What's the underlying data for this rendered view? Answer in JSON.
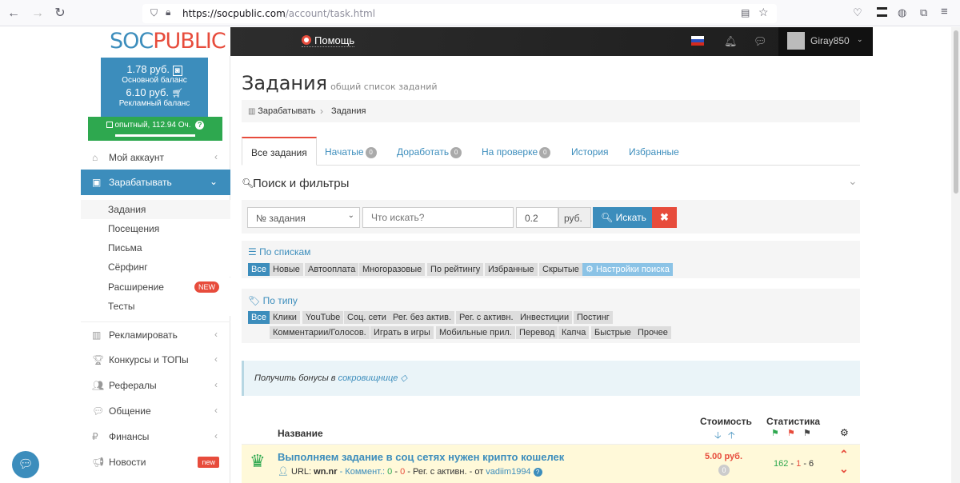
{
  "browser": {
    "url_host": "https://socpublic.com",
    "url_path": "/account/task.html"
  },
  "header": {
    "logo": "SOCPUBLIC",
    "help": "Помощь",
    "username": "Giray850"
  },
  "balance": {
    "main_amount": "1.78 руб.",
    "main_label": "Основной баланс",
    "ad_amount": "6.10 руб.",
    "ad_label": "Рекламный баланс",
    "level": "опытный, 112.94 Оч."
  },
  "sidebar": {
    "account": "Мой аккаунт",
    "earn": "Зарабатывать",
    "sub": [
      "Задания",
      "Посещения",
      "Письма",
      "Сёрфинг",
      "Расширение",
      "Тесты"
    ],
    "sub_badge": "NEW",
    "advertise": "Рекламировать",
    "contests": "Конкурсы и ТОПы",
    "referrals": "Рефералы",
    "chat": "Общение",
    "finance": "Финансы",
    "news": "Новости",
    "news_badge": "new"
  },
  "page": {
    "title": "Задания",
    "subtitle": "общий список заданий",
    "crumb1": "Зарабатывать",
    "crumb2": "Задания"
  },
  "tabs": [
    {
      "label": "Все задания"
    },
    {
      "label": "Начатые",
      "count": "0"
    },
    {
      "label": "Доработать",
      "count": "0"
    },
    {
      "label": "На проверке",
      "count": "0"
    },
    {
      "label": "История"
    },
    {
      "label": "Избранные"
    }
  ],
  "search": {
    "title": "Поиск и фильтры",
    "select": "№ задания",
    "placeholder": "Что искать?",
    "price": "0.2",
    "currency": "руб.",
    "button": "Искать"
  },
  "lists": {
    "label": "По спискам",
    "items": [
      "Все",
      "Новые",
      "Автооплата",
      "Многоразовые",
      "По рейтингу",
      "Избранные",
      "Скрытые"
    ],
    "settings": "Настройки поиска"
  },
  "types": {
    "label": "По типу",
    "row1": [
      "Все",
      "Клики",
      "YouTube",
      "Соц. сети",
      "Рег. без актив.",
      "Рег. с активн.",
      "Инвестиции",
      "Постинг"
    ],
    "row2": [
      "Комментарии/Голосов.",
      "Играть в игры",
      "Мобильные прил.",
      "Перевод",
      "Капча",
      "Быстрые",
      "Прочее"
    ]
  },
  "bonus": {
    "text": "Получить бонусы в",
    "link": "сокровищнице"
  },
  "table": {
    "col_name": "Название",
    "col_cost": "Стоимость",
    "col_stats": "Статистика"
  },
  "task": {
    "title": "Выполняем задание в соц сетях нужен крипто кошелек",
    "url_label": "URL:",
    "url": "wn.nr",
    "comment_label": "Коммент.:",
    "c1": "0",
    "c2": "0",
    "type": "Рег. с активн.",
    "author_prefix": "от",
    "author": "vadiim1994",
    "price": "5.00 руб.",
    "price_count": "0",
    "stat1": "162",
    "stat2": "1",
    "stat3": "6"
  },
  "colors": {
    "primary": "#3c8dbc",
    "danger": "#e74c3c",
    "success": "#2ea84f"
  }
}
